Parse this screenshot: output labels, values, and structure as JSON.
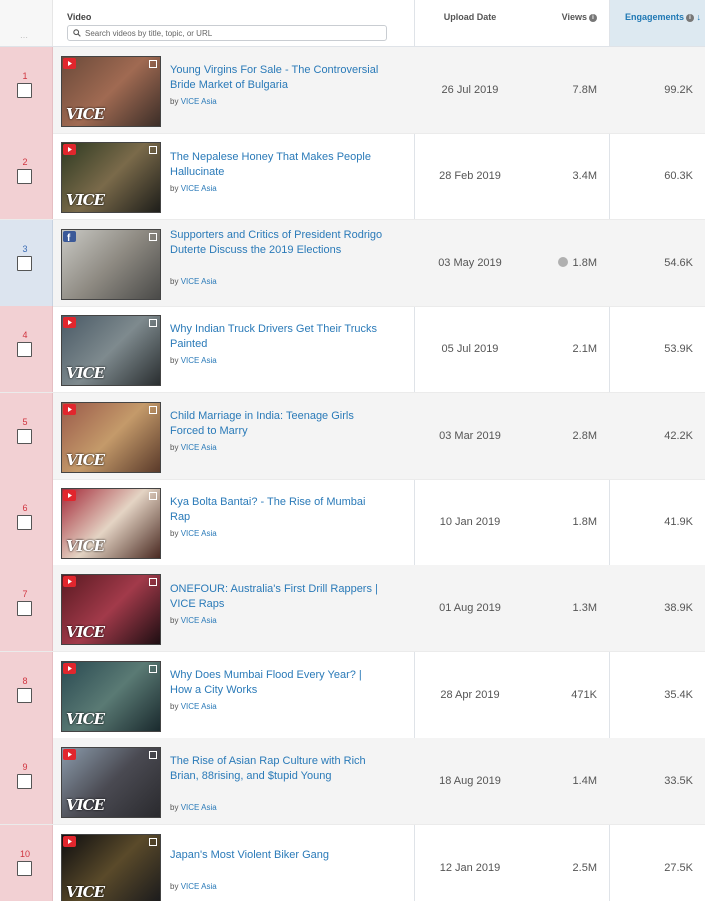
{
  "header": {
    "video_label": "Video",
    "search_placeholder": "Search videos by title, topic, or URL",
    "upload_label": "Upload Date",
    "views_label": "Views",
    "engagements_label": "Engagements",
    "sort_arrow": "↓",
    "info_glyph": "i"
  },
  "rows": [
    {
      "rank": "1",
      "platform": "youtube",
      "title": "Young Virgins For Sale - The Controversial Bride Market of Bulgaria",
      "by": "by",
      "channel": "VICE Asia",
      "date": "26 Jul 2019",
      "views": "7.8M",
      "engagements": "99.2K",
      "thumb_colors": [
        "#6b4a3a",
        "#a06a52",
        "#3c2e28"
      ],
      "selected": false
    },
    {
      "rank": "2",
      "platform": "youtube",
      "title": "The Nepalese Honey That Makes People Hallucinate",
      "by": "by",
      "channel": "VICE Asia",
      "date": "28 Feb 2019",
      "views": "3.4M",
      "engagements": "60.3K",
      "thumb_colors": [
        "#2e3a22",
        "#7a6a4a",
        "#1e1e1a"
      ],
      "selected": false
    },
    {
      "rank": "3",
      "platform": "facebook",
      "title": "Supporters and Critics of President Rodrigo Duterte Discuss the 2019 Elections",
      "by": "by",
      "channel": "VICE Asia",
      "date": "03 May 2019",
      "views": "1.8M",
      "engagements": "54.6K",
      "thumb_colors": [
        "#c9c9c4",
        "#8e8a82",
        "#4a4a48"
      ],
      "selected": false
    },
    {
      "rank": "4",
      "platform": "youtube",
      "title": "Why Indian Truck Drivers Get Their Trucks Painted",
      "by": "by",
      "channel": "VICE Asia",
      "date": "05 Jul 2019",
      "views": "2.1M",
      "engagements": "53.9K",
      "thumb_colors": [
        "#4a5a66",
        "#7e8a8e",
        "#2a2e30"
      ],
      "selected": false
    },
    {
      "rank": "5",
      "platform": "youtube",
      "title": "Child Marriage in India: Teenage Girls Forced to Marry",
      "by": "by",
      "channel": "VICE Asia",
      "date": "03 Mar 2019",
      "views": "2.8M",
      "engagements": "42.2K",
      "thumb_colors": [
        "#9a5a4a",
        "#c49a6a",
        "#5a3a2a"
      ],
      "selected": false
    },
    {
      "rank": "6",
      "platform": "youtube",
      "title": "Kya Bolta Bantai? - The Rise of Mumbai Rap",
      "by": "by",
      "channel": "VICE Asia",
      "date": "10 Jan 2019",
      "views": "1.8M",
      "engagements": "41.9K",
      "thumb_colors": [
        "#a42a3a",
        "#e4d4c4",
        "#4a2a22"
      ],
      "selected": false
    },
    {
      "rank": "7",
      "platform": "youtube",
      "title": "ONEFOUR: Australia's First Drill Rappers | VICE Raps",
      "by": "by",
      "channel": "VICE Asia",
      "date": "01 Aug 2019",
      "views": "1.3M",
      "engagements": "38.9K",
      "thumb_colors": [
        "#5a1a22",
        "#a23a4a",
        "#1e0e12"
      ],
      "selected": false
    },
    {
      "rank": "8",
      "platform": "youtube",
      "title": "Why Does Mumbai Flood Every Year? | How a City Works",
      "by": "by",
      "channel": "VICE Asia",
      "date": "28 Apr 2019",
      "views": "471K",
      "engagements": "35.4K",
      "thumb_colors": [
        "#2a4a52",
        "#5a7a74",
        "#1a2a2e"
      ],
      "selected": false
    },
    {
      "rank": "9",
      "platform": "youtube",
      "title": "The Rise of Asian Rap Culture with Rich Brian, 88rising, and $tupid Young",
      "by": "by",
      "channel": "VICE Asia",
      "date": "18 Aug 2019",
      "views": "1.4M",
      "engagements": "33.5K",
      "thumb_colors": [
        "#8a9aaa",
        "#4a4a52",
        "#2a2a2e"
      ],
      "selected": false
    },
    {
      "rank": "10",
      "platform": "youtube",
      "title": "Japan's Most Violent Biker Gang",
      "by": "by",
      "channel": "VICE Asia",
      "date": "12 Jan 2019",
      "views": "2.5M",
      "engagements": "27.5K",
      "thumb_colors": [
        "#0e0e10",
        "#5a4a2a",
        "#1a1a1c"
      ],
      "selected": false
    }
  ],
  "vice_logo_text": "VICE",
  "colors": {
    "link": "#2a7ab8",
    "rank_red": "#d0343f",
    "rank_bg": "#f2d0d3",
    "rank_bg_fb": "#dce4ef",
    "sort_header_bg": "#dde9f1"
  }
}
